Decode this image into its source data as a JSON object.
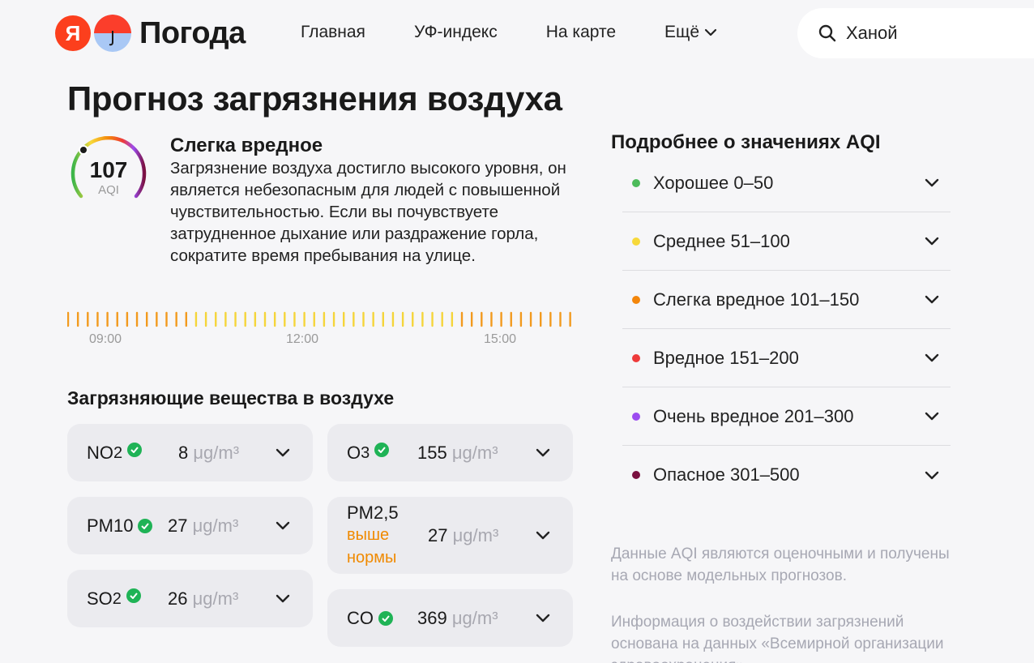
{
  "header": {
    "logo_letter": "Я",
    "logo_text": "Погода",
    "nav": [
      "Главная",
      "УФ-индекс",
      "На карте",
      "Ещё"
    ],
    "search_value": "Ханой"
  },
  "page_title": "Прогноз загрязнения воздуха",
  "aqi": {
    "value": "107",
    "unit": "AQI",
    "level": "Слегка вредное",
    "description": "Загрязнение воздуха достигло высокого уровня, он является небезопасным для людей с повышенной чувствительностью. Если вы почувствуете затрудненное дыхание или раздражение горла, сократите время пребывания на улице."
  },
  "timeline": {
    "labels": [
      "09:00",
      "12:00",
      "15:00"
    ],
    "colors": {
      "orange": "#f29a1e",
      "yellow": "#f5d53a"
    }
  },
  "pollutants": {
    "title": "Загрязняющие вещества в воздухе",
    "items": [
      {
        "name": "NO",
        "sub": "2",
        "value": "8",
        "unit": "μg/m³",
        "status_icon": "check-icon"
      },
      {
        "name": "O",
        "sub": "3",
        "value": "155",
        "unit": "μg/m³",
        "status_icon": "check-icon"
      },
      {
        "name": "PM10",
        "sub": "",
        "value": "27",
        "unit": "μg/m³",
        "status_icon": "check-icon"
      },
      {
        "name": "PM2,5",
        "sub": "",
        "value": "27",
        "unit": "μg/m³",
        "warning": "выше нормы"
      },
      {
        "name": "SO",
        "sub": "2",
        "value": "26",
        "unit": "μg/m³",
        "status_icon": "check-icon"
      },
      {
        "name": "CO",
        "sub": "",
        "value": "369",
        "unit": "μg/m³",
        "status_icon": "check-icon"
      }
    ]
  },
  "aqi_scale": {
    "title": "Подробнее о значениях AQI",
    "items": [
      {
        "label": "Хорошее 0–50",
        "color": "#4cbb5a"
      },
      {
        "label": "Среднее 51–100",
        "color": "#f7d93a"
      },
      {
        "label": "Слегка вредное 101–150",
        "color": "#f3860b"
      },
      {
        "label": "Вредное 151–200",
        "color": "#ee3a3a"
      },
      {
        "label": "Очень вредное 201–300",
        "color": "#9b4cf0"
      },
      {
        "label": "Опасное 301–500",
        "color": "#7a1040"
      }
    ]
  },
  "notes": [
    "Данные AQI являются оценочными и получены на основе модельных прогнозов.",
    "Информация о воздействии загрязнений основана на данных «Всемирной организации здравоохранения»"
  ]
}
